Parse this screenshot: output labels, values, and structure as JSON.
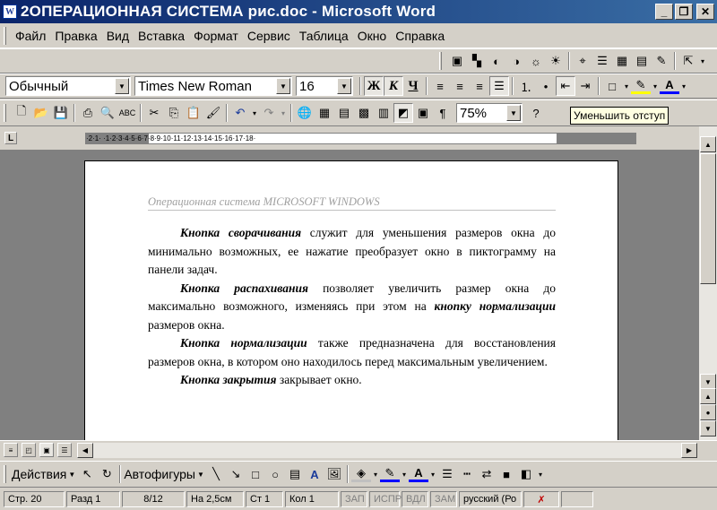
{
  "window": {
    "title": "2ОПЕРАЦИОННАЯ СИСТЕМА рис.doc - Microsoft Word",
    "icon": "word-doc-icon"
  },
  "menu": {
    "items": [
      "Файл",
      "Правка",
      "Вид",
      "Вставка",
      "Формат",
      "Сервис",
      "Таблица",
      "Окно",
      "Справка"
    ]
  },
  "formatting": {
    "style": "Обычный",
    "font": "Times New Roman",
    "size": "16",
    "bold": "Ж",
    "italic": "К",
    "underline": "Ч"
  },
  "standard": {
    "zoom": "75%",
    "pilcrow": "¶"
  },
  "tooltip": "Уменьшить отступ",
  "ruler": {
    "numbers": "·2·1· ·1·2·3·4·5·6·7·8·9·10·11·12·13·14·15·16·17·18·"
  },
  "document": {
    "header": "Операционная система MICROSOFT WINDOWS",
    "paragraphs": [
      {
        "bold": "Кнопка сворачивания",
        "text": "  служит для уменьшения размеров окна до минимально возможных, ее нажатие преобразует окно в пиктограмму на панели задач."
      },
      {
        "bold": "Кнопка распахивания",
        "text": "  позволяет увеличить размер окна до максимально возможного, изменяясь при этом на ",
        "bold2": "кнопку нормализации",
        "text2": " размеров окна."
      },
      {
        "bold": "Кнопка нормализации",
        "text": " также предназначена для восстановления размеров окна, в котором оно находилось перед максимальным увеличением."
      },
      {
        "bold": "Кнопка закрытия",
        "text": " закрывает окно."
      }
    ]
  },
  "drawing": {
    "actions": "Действия",
    "autoshapes": "Автофигуры"
  },
  "status": {
    "page": "Стр. 20",
    "section": "Разд 1",
    "pages": "8/12",
    "at": "На 2,5см",
    "line": "Ст 1",
    "col": "Кол 1",
    "rec": "ЗАП",
    "trk": "ИСПР",
    "ext": "ВДЛ",
    "ovr": "ЗАМ",
    "lang": "русский (Ро"
  }
}
